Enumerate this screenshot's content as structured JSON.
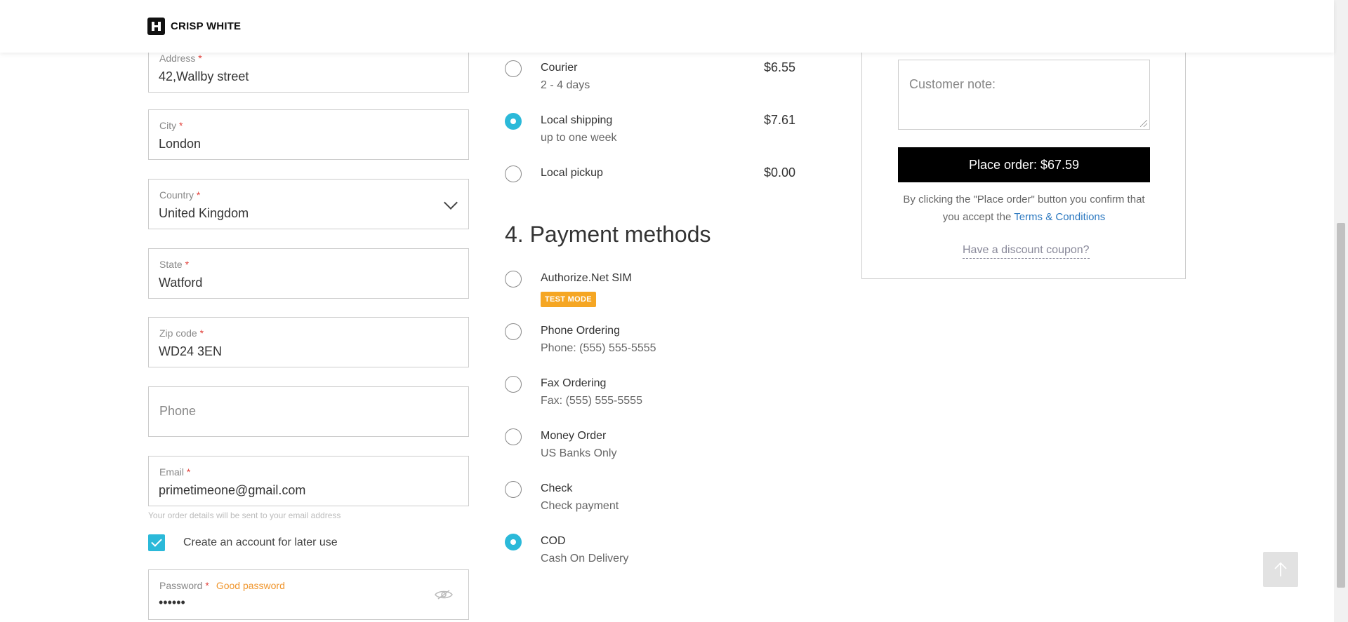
{
  "header": {
    "logo_text": "CRISP WHITE"
  },
  "address_form": {
    "address": {
      "label": "Address",
      "value": "42,Wallby street"
    },
    "city": {
      "label": "City",
      "value": "London"
    },
    "country": {
      "label": "Country",
      "value": "United Kingdom"
    },
    "state": {
      "label": "State",
      "value": "Watford"
    },
    "zip": {
      "label": "Zip code",
      "value": "WD24 3EN"
    },
    "phone": {
      "placeholder": "Phone"
    },
    "email": {
      "label": "Email",
      "value": "primetimeone@gmail.com",
      "hint": "Your order details will be sent to your email address"
    },
    "create_account": {
      "label": "Create an account for later use",
      "checked": true
    },
    "password": {
      "label": "Password",
      "strength": "Good password",
      "value": "••••••"
    },
    "required_mark": "*"
  },
  "shipping": {
    "options": [
      {
        "name": "Courier",
        "sub": "2 - 4 days",
        "price": "$6.55",
        "selected": false
      },
      {
        "name": "Local shipping",
        "sub": "up to one week",
        "price": "$7.61",
        "selected": true
      },
      {
        "name": "Local pickup",
        "sub": "",
        "price": "$0.00",
        "selected": false
      }
    ]
  },
  "payment": {
    "title": "4. Payment methods",
    "options": [
      {
        "name": "Authorize.Net SIM",
        "badge": "TEST MODE",
        "selected": false
      },
      {
        "name": "Phone Ordering",
        "sub": "Phone: (555) 555-5555",
        "selected": false
      },
      {
        "name": "Fax Ordering",
        "sub": "Fax: (555) 555-5555",
        "selected": false
      },
      {
        "name": "Money Order",
        "sub": "US Banks Only",
        "selected": false
      },
      {
        "name": "Check",
        "sub": "Check payment",
        "selected": false
      },
      {
        "name": "COD",
        "sub": "Cash On Delivery",
        "selected": true
      }
    ]
  },
  "summary": {
    "note_placeholder": "Customer note:",
    "place_order": "Place order: $67.59",
    "confirm_text": "By clicking the \"Place order\" button you confirm that you accept the",
    "terms_link": "Terms & Conditions",
    "coupon_link": "Have a discount coupon?"
  },
  "colors": {
    "accent": "#2bb9d9",
    "required": "#e2403a",
    "strength": "#f0962e",
    "badge": "#f5a623",
    "link": "#2b78c0"
  },
  "icons": {
    "back_to_top": "arrow-up-icon",
    "password_toggle": "eye-off-icon",
    "country_select": "chevron-down-icon"
  }
}
